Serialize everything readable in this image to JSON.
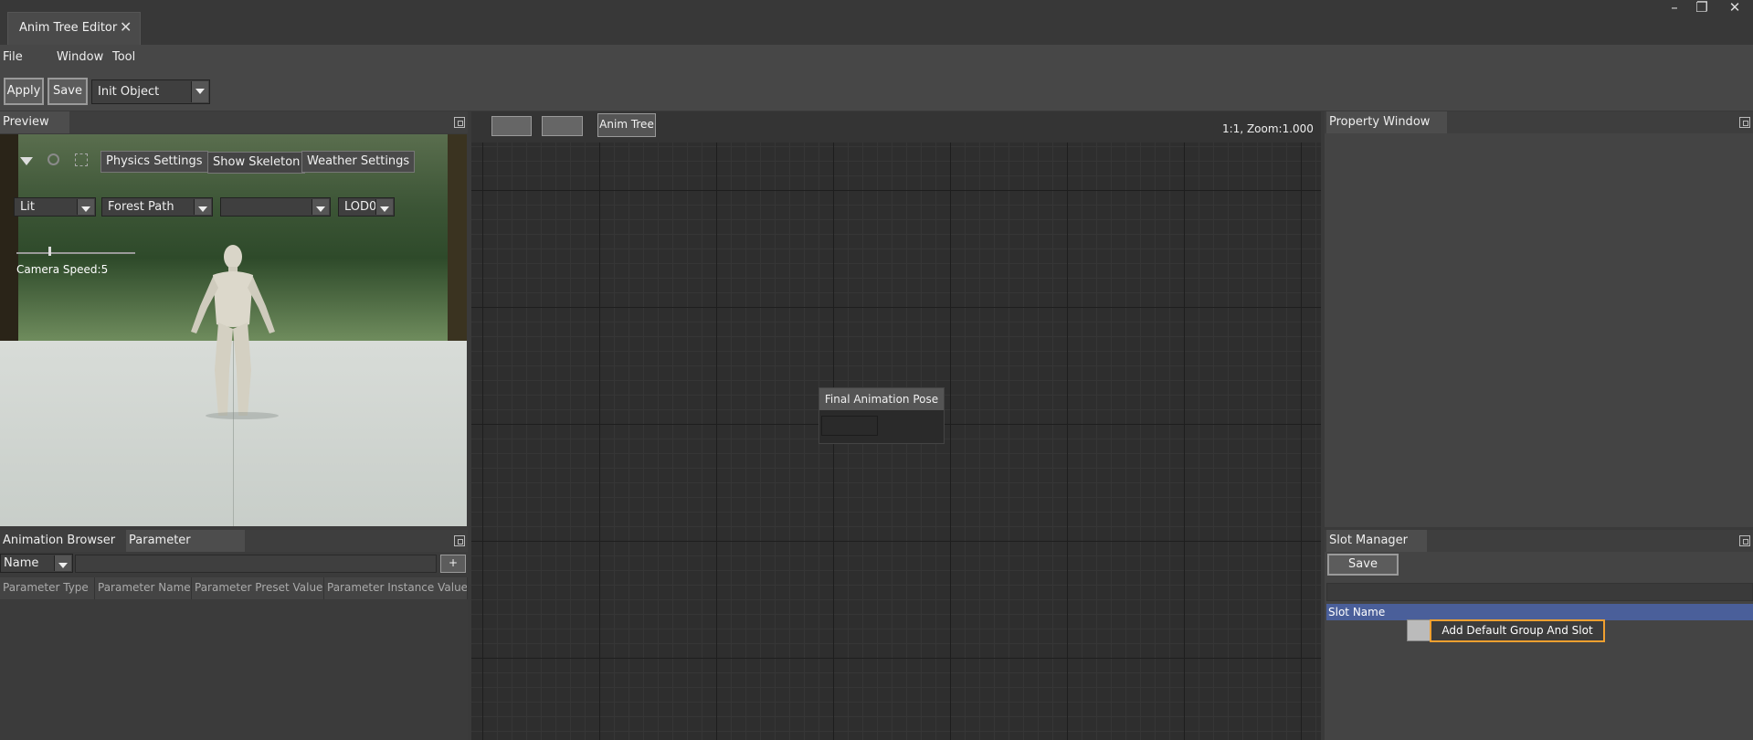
{
  "window": {
    "tab_title": "Anim Tree Editor",
    "controls": {
      "minimize": "–",
      "restore": "❐",
      "close": "✕"
    }
  },
  "menu": [
    "File",
    "Window",
    "Tool"
  ],
  "toolbar": {
    "apply_label": "Apply",
    "save_label": "Save",
    "object_select": "Init Object"
  },
  "preview": {
    "tab": "Preview",
    "buttons": [
      "Physics Settings",
      "Show Skeleton",
      "Weather Settings"
    ],
    "dropdowns": {
      "view_mode": "Lit",
      "environment": "Forest Path",
      "empty": "",
      "lod": "LOD0"
    },
    "camera_speed_label": "Camera Speed:5",
    "camera_speed_value": 5
  },
  "graph": {
    "tabs": [
      "",
      "",
      "Anim Tree"
    ],
    "zoom_label": "1:1, Zoom:1.000",
    "node_title": "Final Animation Pose"
  },
  "bottom_left": {
    "tabs": [
      "Animation Browser",
      "Parameter"
    ],
    "filter_select": "Name",
    "add_label": "+",
    "columns": [
      "Parameter Type",
      "Parameter Name",
      "Parameter Preset Value",
      "Parameter Instance Value"
    ]
  },
  "property_window": {
    "tab": "Property Window"
  },
  "slot_manager": {
    "tab": "Slot Manager",
    "save_label": "Save",
    "slot_name_header": "Slot Name",
    "context_menu_item": "Add Default Group And Slot"
  },
  "colors": {
    "accent_orange": "#f0a030",
    "selection_blue": "#4a5f9a"
  }
}
